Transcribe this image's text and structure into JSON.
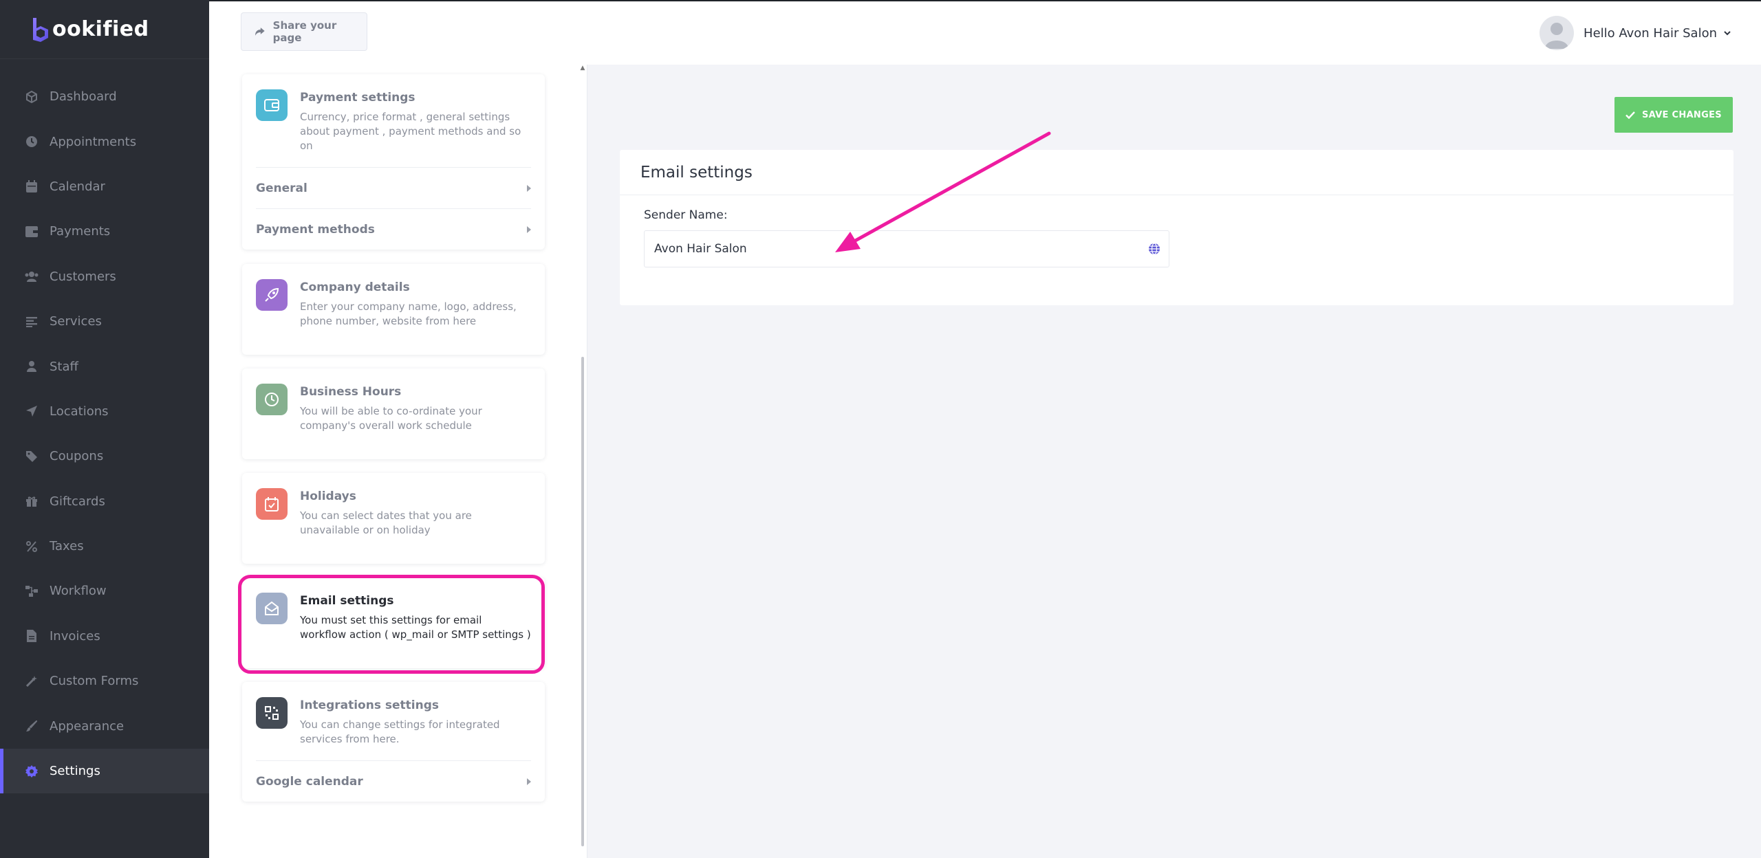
{
  "brand": {
    "name": "ookified",
    "accent": "#6c63ff"
  },
  "header": {
    "share_label": "Share your page",
    "greeting": "Hello Avon Hair Salon"
  },
  "sidebar": {
    "items": [
      {
        "label": "Dashboard",
        "icon": "dashboard-icon"
      },
      {
        "label": "Appointments",
        "icon": "clock-icon"
      },
      {
        "label": "Calendar",
        "icon": "calendar-icon"
      },
      {
        "label": "Payments",
        "icon": "wallet-icon"
      },
      {
        "label": "Customers",
        "icon": "users-icon"
      },
      {
        "label": "Services",
        "icon": "list-icon"
      },
      {
        "label": "Staff",
        "icon": "user-icon"
      },
      {
        "label": "Locations",
        "icon": "location-arrow-icon"
      },
      {
        "label": "Coupons",
        "icon": "tag-icon"
      },
      {
        "label": "Giftcards",
        "icon": "gift-icon"
      },
      {
        "label": "Taxes",
        "icon": "percent-icon"
      },
      {
        "label": "Workflow",
        "icon": "workflow-icon"
      },
      {
        "label": "Invoices",
        "icon": "file-icon"
      },
      {
        "label": "Custom Forms",
        "icon": "magic-icon"
      },
      {
        "label": "Appearance",
        "icon": "brush-icon"
      },
      {
        "label": "Settings",
        "icon": "gear-icon",
        "active": true
      }
    ]
  },
  "settings_cards": {
    "payment": {
      "title": "Payment settings",
      "desc": "Currency, price format , general settings about payment , payment methods and so on",
      "sub": [
        "General",
        "Payment methods"
      ]
    },
    "company": {
      "title": "Company details",
      "desc": "Enter your company name, logo, address, phone number, website from here"
    },
    "hours": {
      "title": "Business Hours",
      "desc": "You will be able to co-ordinate your company's overall work schedule"
    },
    "holidays": {
      "title": "Holidays",
      "desc": "You can select dates that you are unavailable or on holiday"
    },
    "email": {
      "title": "Email settings",
      "desc": "You must set this settings for email workflow action ( wp_mail or SMTP settings )"
    },
    "integrations": {
      "title": "Integrations settings",
      "desc": "You can change settings for integrated services from here.",
      "sub": [
        "Google calendar"
      ]
    }
  },
  "main": {
    "save_label": "SAVE CHANGES",
    "panel_title": "Email settings",
    "sender_label": "Sender Name:",
    "sender_value": "Avon Hair Salon"
  },
  "colors": {
    "sidebar_bg": "#2a2d34",
    "save_green": "#66cc6e",
    "highlight_magenta": "#ee1ca0",
    "payment_icon": "#4fb8d4",
    "company_icon": "#9b6fd1",
    "hours_icon": "#86b08f",
    "holidays_icon": "#ee7a6e",
    "email_icon": "#a0aec8",
    "integrations_icon": "#444b55"
  }
}
